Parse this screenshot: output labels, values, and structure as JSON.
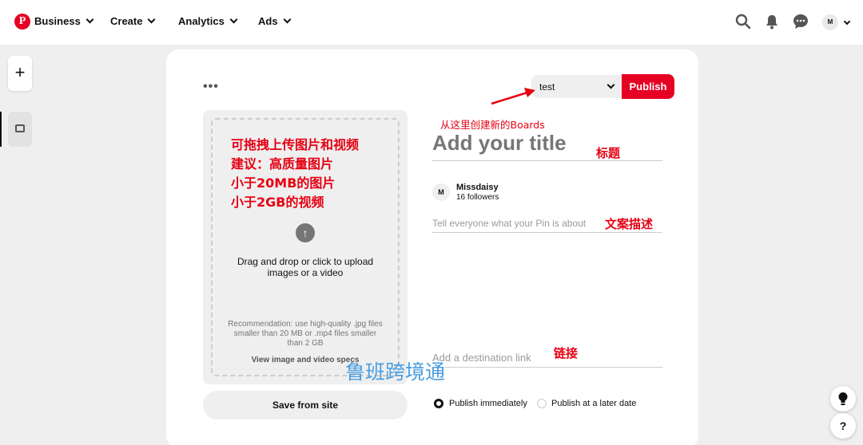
{
  "nav": {
    "logo_letter": "P",
    "business": "Business",
    "create": "Create",
    "analytics": "Analytics",
    "ads": "Ads",
    "avatar_initial": "M"
  },
  "rail": {
    "add_symbol": "+"
  },
  "card": {
    "more_label": "•••",
    "board_value": "test",
    "publish_label": "Publish",
    "upload_arrow": "↑",
    "upload_text": "Drag and drop or click to upload images or a video",
    "upload_recommendation": "Recommendation: use high-quality .jpg files smaller than 20 MB or .mp4 files smaller than 2 GB",
    "upload_specs_link": "View image and video specs",
    "save_from_site": "Save from site",
    "title_placeholder": "Add your title",
    "user_initial": "M",
    "user_name": "Missdaisy",
    "user_followers": "16 followers",
    "description_placeholder": "Tell everyone what your Pin is about",
    "link_placeholder": "Add a destination link",
    "publish_now": "Publish immediately",
    "publish_later": "Publish at a later date"
  },
  "annotations": {
    "upload_line1": "可拖拽上传图片和视频",
    "upload_line2": "建议：高质量图片",
    "upload_line3": "小于20MB的图片",
    "upload_line4": "小于2GB的视频",
    "boards": "从这里创建新的Boards",
    "title": "标题",
    "description": "文案描述",
    "link": "链接",
    "watermark": "鲁班跨境通"
  },
  "floating": {
    "help": "?"
  },
  "colors": {
    "brand": "#e60023",
    "annotation": "#e60012",
    "watermark": "#4a9ee0"
  }
}
